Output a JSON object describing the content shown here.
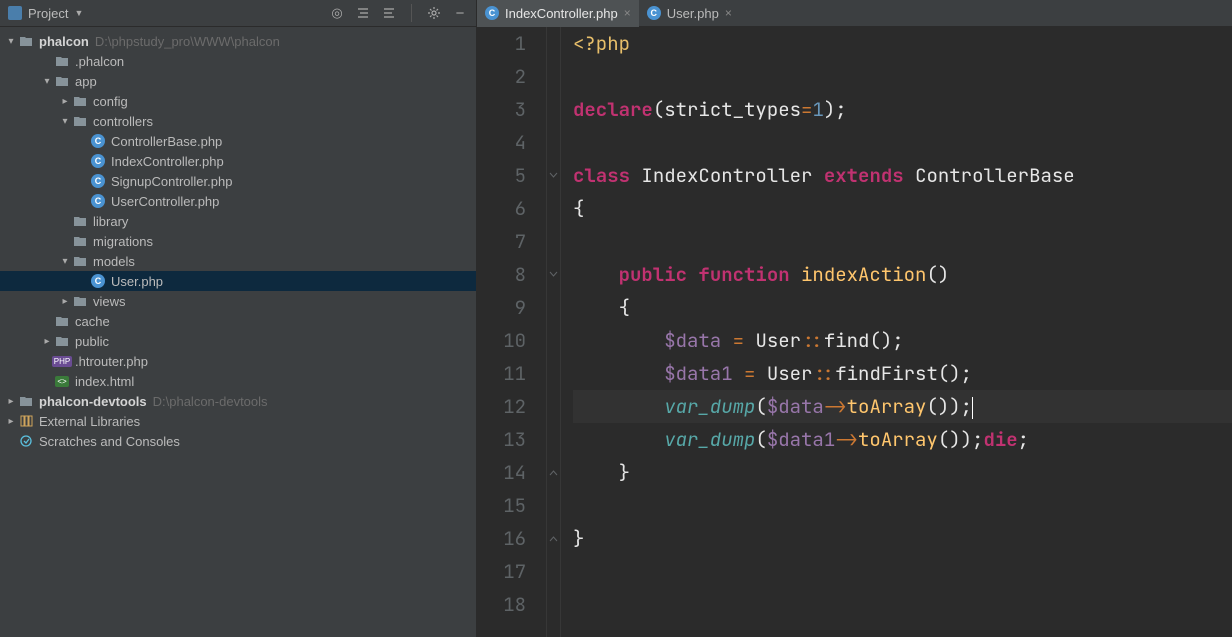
{
  "sidebar": {
    "title": "Project",
    "tree": {
      "root": {
        "name": "phalcon",
        "path": "D:\\phpstudy_pro\\WWW\\phalcon"
      },
      "items": [
        {
          "name": ".phalcon",
          "type": "folder",
          "indent": 2,
          "expanded": null
        },
        {
          "name": "app",
          "type": "folder",
          "indent": 2,
          "expanded": true
        },
        {
          "name": "config",
          "type": "folder",
          "indent": 3,
          "expanded": false
        },
        {
          "name": "controllers",
          "type": "folder",
          "indent": 3,
          "expanded": true
        },
        {
          "name": "ControllerBase.php",
          "type": "php",
          "indent": 4
        },
        {
          "name": "IndexController.php",
          "type": "php",
          "indent": 4
        },
        {
          "name": "SignupController.php",
          "type": "php",
          "indent": 4
        },
        {
          "name": "UserController.php",
          "type": "php",
          "indent": 4
        },
        {
          "name": "library",
          "type": "folder",
          "indent": 3,
          "expanded": null
        },
        {
          "name": "migrations",
          "type": "folder",
          "indent": 3,
          "expanded": null
        },
        {
          "name": "models",
          "type": "folder",
          "indent": 3,
          "expanded": true
        },
        {
          "name": "User.php",
          "type": "php",
          "indent": 4,
          "selected": true
        },
        {
          "name": "views",
          "type": "folder",
          "indent": 3,
          "expanded": false
        },
        {
          "name": "cache",
          "type": "folder",
          "indent": 2,
          "expanded": null
        },
        {
          "name": "public",
          "type": "folder",
          "indent": 2,
          "expanded": false
        },
        {
          "name": ".htrouter.php",
          "type": "phpfile",
          "indent": 2
        },
        {
          "name": "index.html",
          "type": "html",
          "indent": 2
        }
      ],
      "devtools": {
        "name": "phalcon-devtools",
        "path": "D:\\phalcon-devtools"
      },
      "external_libs": "External Libraries",
      "scratches": "Scratches and Consoles"
    }
  },
  "tabs": [
    {
      "name": "IndexController.php",
      "active": true
    },
    {
      "name": "User.php",
      "active": false
    }
  ],
  "code": {
    "lines": [
      1,
      2,
      3,
      4,
      5,
      6,
      7,
      8,
      9,
      10,
      11,
      12,
      13,
      14,
      15,
      16,
      17,
      18
    ],
    "highlight_line": 12,
    "tokens": {
      "php_open": "<?php",
      "declare": "declare",
      "strict": "strict_types",
      "one": "1",
      "class": "class",
      "cls_name": "IndexController",
      "extends": "extends",
      "base": "ControllerBase",
      "public": "public",
      "function": "function",
      "action": "indexAction",
      "var_data": "$data",
      "var_data1": "$data1",
      "user": "User",
      "find": "find",
      "findFirst": "findFirst",
      "var_dump": "var_dump",
      "toArray": "toArray",
      "die": "die"
    }
  }
}
